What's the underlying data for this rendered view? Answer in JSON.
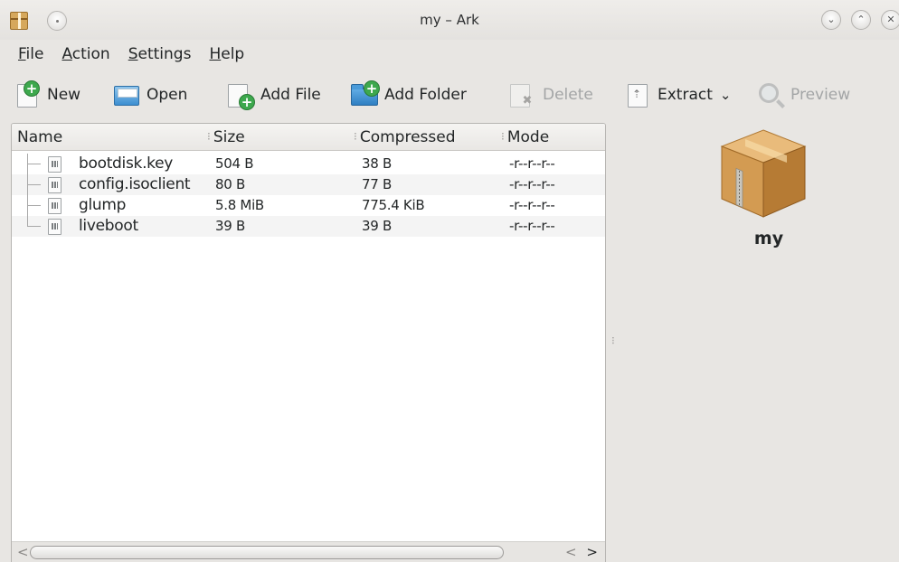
{
  "window": {
    "title": "my – Ark",
    "minimize_glyph": "⌄",
    "maximize_glyph": "⌃",
    "close_glyph": "✕"
  },
  "menubar": {
    "items": [
      {
        "accel": "F",
        "rest": "ile"
      },
      {
        "accel": "A",
        "rest": "ction"
      },
      {
        "accel": "S",
        "rest": "ettings"
      },
      {
        "accel": "H",
        "rest": "elp"
      }
    ]
  },
  "toolbar": {
    "new_label": "New",
    "open_label": "Open",
    "add_file_label": "Add File",
    "add_folder_label": "Add Folder",
    "delete_label": "Delete",
    "extract_label": "Extract",
    "extract_dropdown": "⌄",
    "preview_label": "Preview",
    "plus_glyph": "+",
    "delete_glyph": "✖"
  },
  "file_list": {
    "columns": [
      "Name",
      "Size",
      "Compressed",
      "Mode"
    ],
    "rows": [
      {
        "name": "bootdisk.key",
        "size": "504 B",
        "compressed": "38 B",
        "mode": "-r--r--r--"
      },
      {
        "name": "config.isoclient",
        "size": "80 B",
        "compressed": "77 B",
        "mode": "-r--r--r--"
      },
      {
        "name": "glump",
        "size": "5.8 MiB",
        "compressed": "775.4 KiB",
        "mode": "-r--r--r--"
      },
      {
        "name": "liveboot",
        "size": "39 B",
        "compressed": "39 B",
        "mode": "-r--r--r--"
      }
    ],
    "scroll": {
      "left": "<",
      "arrows_left": "<",
      "arrows_right": ">"
    }
  },
  "info_panel": {
    "archive_name": "my",
    "icon": "archive-box-icon"
  },
  "colors": {
    "box_light": "#e2b06d",
    "box_dark": "#a8712e"
  }
}
